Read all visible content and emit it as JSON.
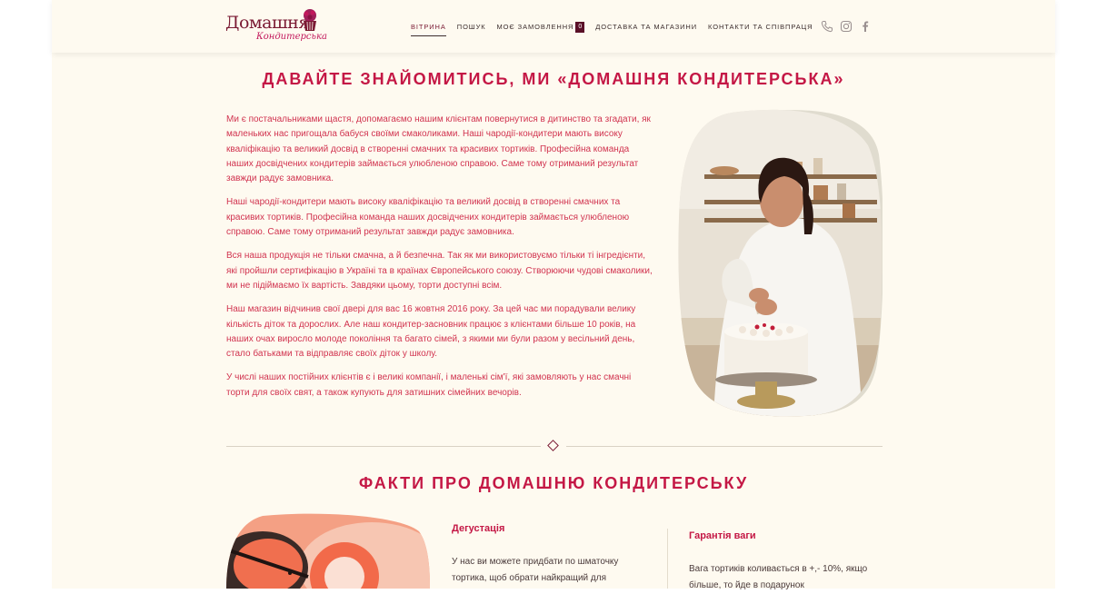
{
  "brand": {
    "logo_main": "Домашня",
    "logo_sub": "Кондитерська"
  },
  "nav": {
    "items": [
      {
        "label": "ВІТРИНА"
      },
      {
        "label": "ПОШУК"
      },
      {
        "label": "МОЄ ЗАМОВЛЕННЯ"
      },
      {
        "label": "ДОСТАВКА ТА МАГАЗИНИ"
      },
      {
        "label": "КОНТАКТИ ТА СПІВПРАЦЯ"
      }
    ],
    "order_count": "0",
    "icons": [
      "phone-icon",
      "instagram-icon",
      "facebook-icon"
    ]
  },
  "about": {
    "title": "ДАВАЙТЕ ЗНАЙОМИТИСЬ, МИ «ДОМАШНЯ КОНДИТЕРСЬКА»",
    "paragraphs": [
      "Ми є постачальниками щастя, допомагаємо нашим клієнтам повернутися в дитинство та згадати, як маленьких нас пригощала бабуся своїми смаколиками. Наші чародії-кондитери мають високу кваліфікацію та великий досвід в створенні смачних та красивих тортиків. Професійна команда наших досвідчених кондитерів займається улюбленою справою. Саме тому отриманий результат завжди радує замовника.",
      "Наші чародії-кондитери мають високу кваліфікацію та великий досвід в створенні смачних та красивих тортиків. Професійна команда наших досвідчених кондитерів займається улюбленою справою. Саме тому отриманий результат завжди радує замовника.",
      "Вся наша продукція не тільки смачна, а й безпечна. Так як ми використовуємо тільки ті інгредієнти, які пройшли сертифікацію в Україні та в країнах Європейського союзу. Створюючи чудові смаколики, ми не підіймаємо їх вартість. Завдяки цьому, торти доступні всім.",
      "Наш магазин відчинив свої двері для вас 16 жовтня 2016 року. За цей час ми порадували велику кількість діток та дорослих. Але наш кондитер-засновник працює з клієнтами більше 10 років, на наших очах виросло молоде покоління та багато сімей, з якими ми були разом у весільний день, стало батьками та відправляє своїх діток у школу.",
      "У числі наших постійних клієнтів є і великі компанії, і маленькі сім'ї, які замовляють у нас смачні торти для своїх свят, а також купують для затишних сімейних вечорів."
    ]
  },
  "facts": {
    "title": "ФАКТИ ПРО ДОМАШНЮ КОНДИТЕРСЬКУ",
    "items": [
      {
        "title": "Дегустація",
        "text": "У нас ви можете придбати по шматочку тортика, щоб обрати найкращий для"
      },
      {
        "title": "Гарантія ваги",
        "text": "Вага тортиків коливається в +,- 10%, якщо більше, то йде в подарунок"
      }
    ]
  },
  "colors": {
    "accent": "#c41745",
    "brand_dark": "#7a1a33",
    "background": "#fefaf0"
  }
}
